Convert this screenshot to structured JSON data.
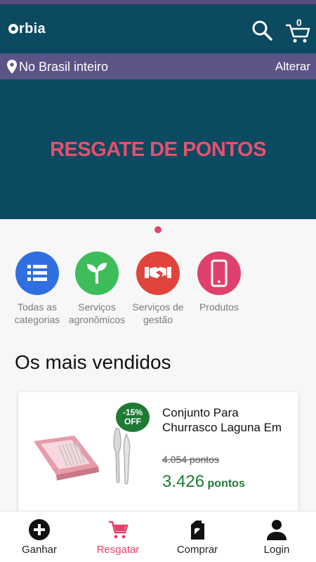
{
  "app": {
    "logo_text": "rbia"
  },
  "header": {
    "cart_count": "0",
    "icons": [
      "search-icon",
      "cart-icon"
    ]
  },
  "location": {
    "label": "No Brasil inteiro",
    "change_label": "Alterar"
  },
  "banner": {
    "title": "RESGATE DE PONTOS"
  },
  "categories": [
    {
      "label": "Todas as categorias",
      "icon": "list-icon",
      "color": "#2f6fe0"
    },
    {
      "label": "Serviços agronômicos",
      "icon": "sprout-icon",
      "color": "#3dbd5a"
    },
    {
      "label": "Serviços de gestão",
      "icon": "handshake-icon",
      "color": "#e0443d"
    },
    {
      "label": "Produtos",
      "icon": "phone-icon",
      "color": "#e0406c"
    }
  ],
  "section": {
    "title": "Os mais vendidos"
  },
  "product": {
    "title": "Conjunto Para Churrasco Laguna Em",
    "discount": "-15% OFF",
    "old_price": "4.054 pontos",
    "new_price_value": "3.426",
    "new_price_unit": "pontos"
  },
  "bottom_nav": [
    {
      "label": "Ganhar",
      "icon": "plus-circle-icon"
    },
    {
      "label": "Resgatar",
      "icon": "cart-icon",
      "active": true
    },
    {
      "label": "Comprar",
      "icon": "canister-icon"
    },
    {
      "label": "Login",
      "icon": "user-icon"
    }
  ],
  "colors": {
    "primary": "#0b4a60",
    "accent": "#e8406a",
    "location_bar": "#5a5487",
    "price_green": "#1e7a32"
  }
}
